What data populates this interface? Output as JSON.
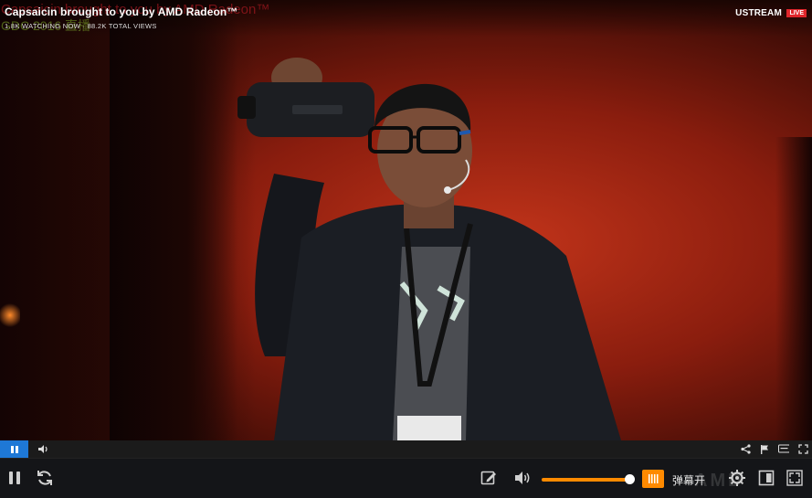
{
  "video": {
    "title": "Capsaicin brought to you by AMD Radeon™",
    "subtitle": "1.8K WATCHING NOW · 88.2K TOTAL VIEWS",
    "overlay_title": "Capsaicin brought to you by AMD Radeon™",
    "overlay_subtitle": "GDC 2016 直播",
    "brand": "USTREAM",
    "live_badge": "LIVE"
  },
  "inner_bar": {
    "play_state": "playing",
    "icons": [
      "pause-icon",
      "speaker-icon",
      "share-icon",
      "flag-icon",
      "captions-icon",
      "fullscreen-icon"
    ]
  },
  "controls": {
    "icons": [
      "pause-icon",
      "refresh-icon",
      "edit-icon",
      "volume-icon",
      "danmaku-icon",
      "settings-icon",
      "pip-icon",
      "fullscreen-icon"
    ],
    "volume_fraction": 0.95,
    "danmaku_label": "弹幕开",
    "watermark": "AMD"
  },
  "colors": {
    "accent": "#ff8a00",
    "inner_play": "#1e78d6",
    "live": "#e0262b"
  }
}
